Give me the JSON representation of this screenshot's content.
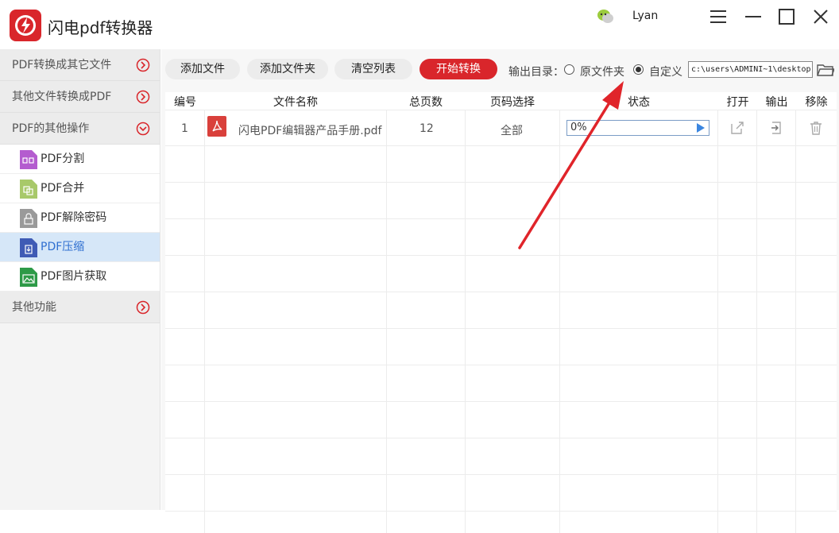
{
  "app": {
    "title": "闪电pdf转换器",
    "user_name": "Lyan",
    "brand_color": "#d9262b"
  },
  "sidebar": {
    "categories": [
      {
        "label": "PDF转换成其它文件",
        "icon": "chevron-right-circle-icon"
      },
      {
        "label": "其他文件转换成PDF",
        "icon": "chevron-right-circle-icon"
      },
      {
        "label": "PDF的其他操作",
        "icon": "chevron-down-circle-icon"
      }
    ],
    "items": [
      {
        "label": "PDF分割",
        "icon": "pdf-split-icon",
        "color": "#b45ccf"
      },
      {
        "label": "PDF合并",
        "icon": "pdf-merge-icon",
        "color": "#a8c96a"
      },
      {
        "label": "PDF解除密码",
        "icon": "pdf-unlock-icon",
        "color": "#9a9a9a"
      },
      {
        "label": "PDF压缩",
        "icon": "pdf-compress-icon",
        "color": "#3f5bb5",
        "active": true
      },
      {
        "label": "PDF图片获取",
        "icon": "pdf-image-icon",
        "color": "#2d9a47"
      }
    ],
    "other": {
      "label": "其他功能",
      "icon": "chevron-right-circle-icon"
    }
  },
  "toolbar": {
    "add_file": "添加文件",
    "add_folder": "添加文件夹",
    "clear_list": "清空列表",
    "start": "开始转换",
    "output_label": "输出目录：",
    "option_original": "原文件夹",
    "option_custom": "自定义",
    "selected_option": "custom",
    "path": "c:\\users\\ADMINI~1\\desktop"
  },
  "table": {
    "headers": [
      "编号",
      "文件名称",
      "总页数",
      "页码选择",
      "状态",
      "打开",
      "输出",
      "移除"
    ],
    "rows": [
      {
        "index": "1",
        "filename": "闪电PDF编辑器产品手册.pdf",
        "pages": "12",
        "page_select": "全部",
        "progress_text": "0%",
        "progress": 0
      }
    ]
  }
}
